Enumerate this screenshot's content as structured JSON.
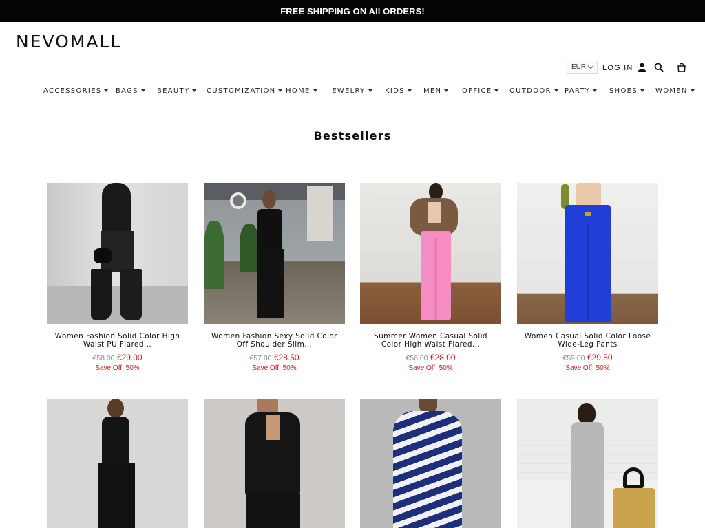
{
  "announcement": "FREE SHIPPING ON All ORDERS!",
  "brand": "NEVOMALL",
  "header": {
    "currency": "EUR",
    "login": "LOG IN",
    "icons": [
      "user-icon",
      "search-icon",
      "cart-icon"
    ]
  },
  "nav": {
    "items": [
      "ACCESSORIES",
      "BAGS",
      "BEAUTY",
      "CUSTOMIZATION",
      "HOME",
      "JEWELRY",
      "KIDS",
      "MEN",
      "OFFICE",
      "OUTDOOR",
      "PARTY",
      "SHOES",
      "WOMEN"
    ]
  },
  "section_title": "Bestsellers",
  "products": [
    {
      "name": "Women Fashion Solid Color High Waist PU Flared...",
      "old_price": "€58.00",
      "price": "€29.00",
      "save": "Save Off: 50%"
    },
    {
      "name": "Women Fashion Sexy Solid Color Off Shoulder Slim...",
      "old_price": "€57.00",
      "price": "€28.50",
      "save": "Save Off: 50%"
    },
    {
      "name": "Summer Women Casual Solid Color High Waist Flared...",
      "old_price": "€56.00",
      "price": "€28.00",
      "save": "Save Off: 50%"
    },
    {
      "name": "Women Casual Solid Color Loose Wide-Leg Pants",
      "old_price": "€59.00",
      "price": "€29.50",
      "save": "Save Off: 50%"
    }
  ],
  "colors": {
    "announcement_bg": "#050505",
    "sale_red": "#d11a1a",
    "old_price_gray": "#8a8a8a"
  }
}
